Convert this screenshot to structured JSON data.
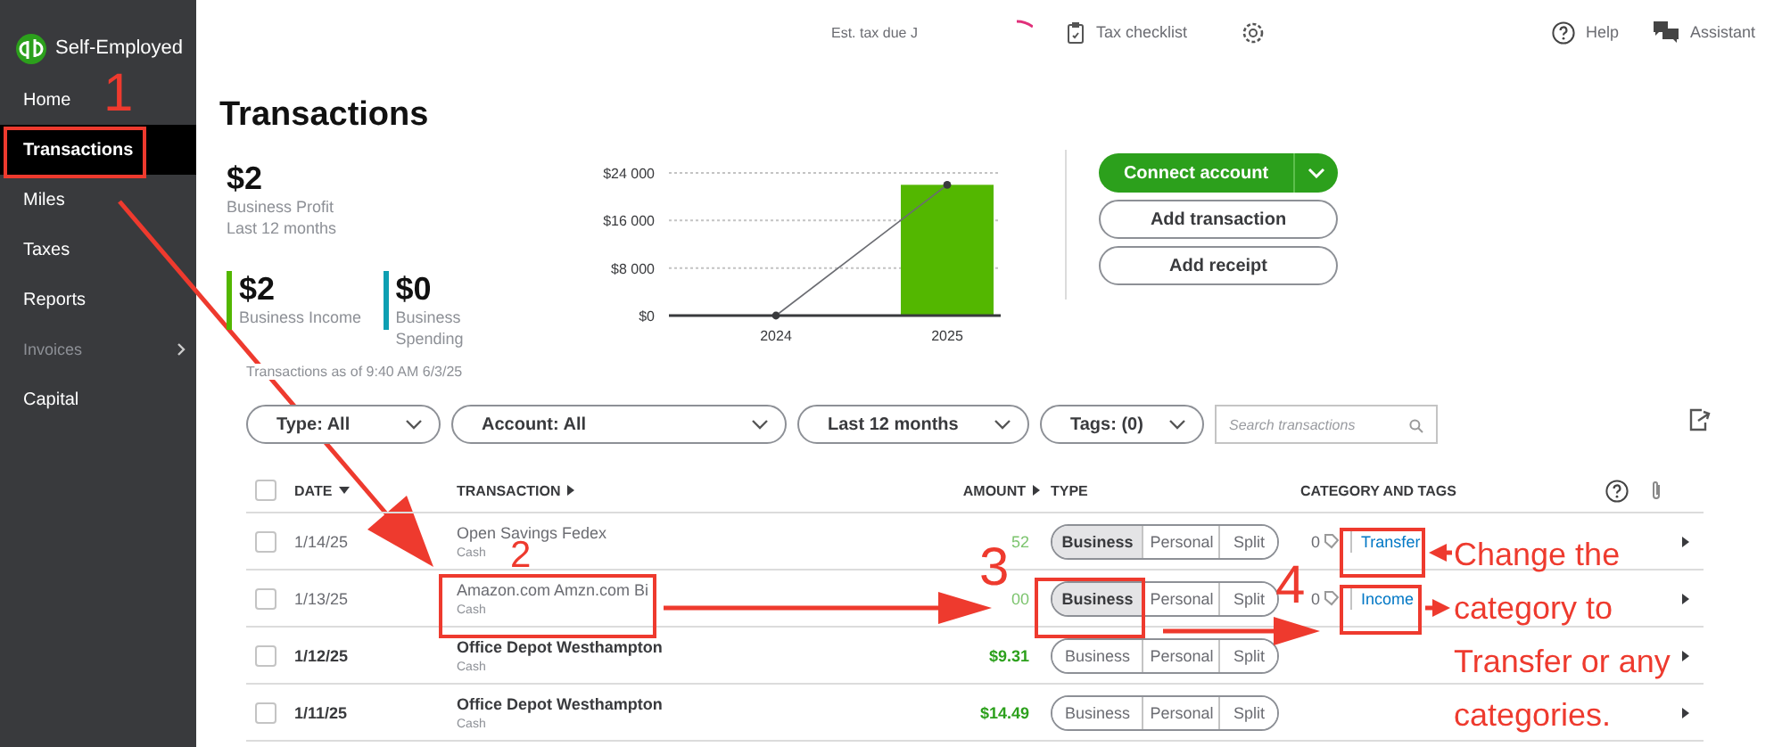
{
  "sidebar": {
    "brand": "Self-Employed",
    "items": [
      {
        "label": "Home",
        "selected": false,
        "has_submenu": false
      },
      {
        "label": "Transactions",
        "selected": true,
        "has_submenu": false
      },
      {
        "label": "Miles",
        "selected": false,
        "has_submenu": false
      },
      {
        "label": "Taxes",
        "selected": false,
        "has_submenu": false
      },
      {
        "label": "Reports",
        "selected": false,
        "has_submenu": false
      },
      {
        "label": "Invoices",
        "selected": false,
        "has_submenu": true
      },
      {
        "label": "Capital",
        "selected": false,
        "has_submenu": false
      }
    ]
  },
  "topbar": {
    "tax_due": "Est. tax due J",
    "checklist": "Tax checklist",
    "help": "Help",
    "assistant": "Assistant"
  },
  "page": {
    "title": "Transactions"
  },
  "summary": {
    "profit": {
      "value": "$2",
      "label": "Business Profit",
      "period": "Last 12 months"
    },
    "stats": [
      {
        "value": "$2",
        "label": "Business Income",
        "color": "#53b700"
      },
      {
        "value": "$0",
        "label": "Business Spending",
        "color": "#0d9fb2"
      }
    ]
  },
  "chart_data": {
    "type": "bar",
    "categories": [
      "2024",
      "2025"
    ],
    "series": [
      {
        "color": "#53b700",
        "values": [
          0,
          22000
        ]
      }
    ],
    "ylim": [
      0,
      24000
    ],
    "yticks": [
      {
        "value": 0,
        "label": "$0"
      },
      {
        "value": 8000,
        "label": "$8 000"
      },
      {
        "value": 16000,
        "label": "$16 000"
      },
      {
        "value": 24000,
        "label": "$24 000"
      }
    ]
  },
  "actions": {
    "primary": "Connect account",
    "secondary": [
      "Add transaction",
      "Add receipt"
    ]
  },
  "as_of": "Transactions as of 9:40 AM 6/3/25",
  "filters": [
    {
      "label": "Type: All"
    },
    {
      "label": "Account: All"
    },
    {
      "label": "Last 12 months"
    },
    {
      "label": "Tags: (0)"
    }
  ],
  "search": {
    "placeholder": "Search transactions"
  },
  "table": {
    "all_checked": false,
    "columns": [
      "DATE",
      "TRANSACTION",
      "AMOUNT",
      "TYPE",
      "CATEGORY AND TAGS"
    ],
    "rows": [
      {
        "checked": false,
        "date": "1/14/25",
        "name": "Open Savings Fedex",
        "account": "Cash",
        "amount": "52",
        "reviewed": true,
        "types": [
          {
            "label": "Business",
            "selected": true
          },
          {
            "label": "Personal",
            "selected": false
          },
          {
            "label": "Split",
            "selected": false
          }
        ],
        "tag_count": "0",
        "category": "Transfer"
      },
      {
        "checked": false,
        "date": "1/13/25",
        "name": "Amazon.com Amzn.com Bi",
        "account": "Cash",
        "amount": "00",
        "reviewed": true,
        "types": [
          {
            "label": "Business",
            "selected": true
          },
          {
            "label": "Personal",
            "selected": false
          },
          {
            "label": "Split",
            "selected": false
          }
        ],
        "tag_count": "0",
        "category": "Income"
      },
      {
        "checked": false,
        "date": "1/12/25",
        "name": "Office Depot Westhampton",
        "account": "Cash",
        "amount": "$9.31",
        "reviewed": false,
        "types": [
          {
            "label": "Business",
            "selected": false
          },
          {
            "label": "Personal",
            "selected": false
          },
          {
            "label": "Split",
            "selected": false
          }
        ]
      },
      {
        "checked": false,
        "date": "1/11/25",
        "name": "Office Depot Westhampton",
        "account": "Cash",
        "amount": "$14.49",
        "reviewed": false,
        "types": [
          {
            "label": "Business",
            "selected": false
          },
          {
            "label": "Personal",
            "selected": false
          },
          {
            "label": "Split",
            "selected": false
          }
        ]
      }
    ]
  },
  "annotations": {
    "steps": [
      "1",
      "2",
      "3",
      "4"
    ],
    "note": "Change the category to Transfer or any categories."
  }
}
